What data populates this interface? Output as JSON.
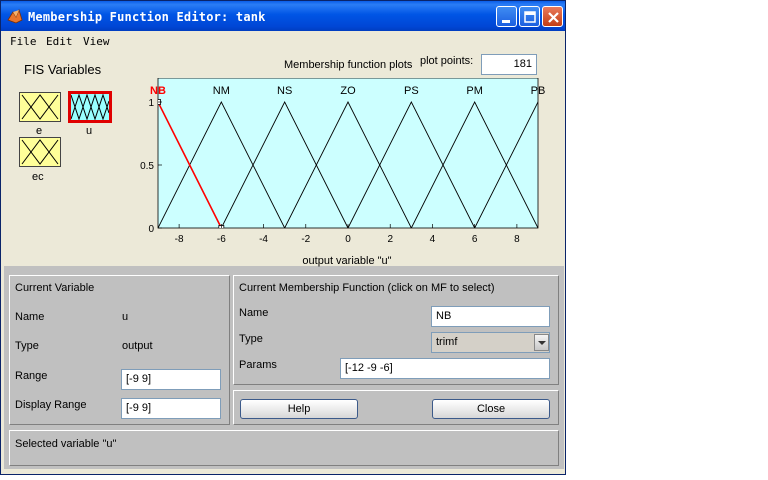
{
  "window": {
    "title": "Membership Function Editor: tank",
    "controls": [
      "minimize-icon",
      "maximize-icon",
      "close-icon"
    ]
  },
  "menu": [
    "File",
    "Edit",
    "View"
  ],
  "fis_variables": {
    "heading": "FIS Variables",
    "inputs": [
      "e",
      "ec"
    ],
    "output": "u",
    "selected": "u"
  },
  "plot": {
    "title": "Membership function plots",
    "plot_points_label": "plot points:",
    "plot_points_value": "181",
    "xlabel": "output variable \"u\"",
    "x_ticks": [
      "-8",
      "-6",
      "-4",
      "-2",
      "0",
      "2",
      "4",
      "6",
      "8"
    ],
    "y_ticks": [
      "0",
      "0.5",
      "1"
    ],
    "mf_labels": [
      "NB",
      "NM",
      "NS",
      "ZO",
      "PS",
      "PM",
      "PB"
    ],
    "background_color": "#ccffff",
    "selected_color": "#ff0000"
  },
  "chart_data": {
    "type": "line",
    "x_range": [
      -9,
      9
    ],
    "y_range": [
      0,
      1
    ],
    "xlabel": "output variable \"u\"",
    "series": [
      {
        "name": "NB",
        "x": [
          -12,
          -9,
          -6
        ],
        "y": [
          0,
          1,
          0
        ]
      },
      {
        "name": "NM",
        "x": [
          -9,
          -6,
          -3
        ],
        "y": [
          0,
          1,
          0
        ]
      },
      {
        "name": "NS",
        "x": [
          -6,
          -3,
          0
        ],
        "y": [
          0,
          1,
          0
        ]
      },
      {
        "name": "ZO",
        "x": [
          -3,
          0,
          3
        ],
        "y": [
          0,
          1,
          0
        ]
      },
      {
        "name": "PS",
        "x": [
          0,
          3,
          6
        ],
        "y": [
          0,
          1,
          0
        ]
      },
      {
        "name": "PM",
        "x": [
          3,
          6,
          9
        ],
        "y": [
          0,
          1,
          0
        ]
      },
      {
        "name": "PB",
        "x": [
          6,
          9,
          12
        ],
        "y": [
          0,
          1,
          0
        ]
      }
    ],
    "selected_series": "NB"
  },
  "current_variable": {
    "heading": "Current Variable",
    "name_label": "Name",
    "name_value": "u",
    "type_label": "Type",
    "type_value": "output",
    "range_label": "Range",
    "range_value": "[-9 9]",
    "display_range_label": "Display Range",
    "display_range_value": "[-9 9]"
  },
  "current_mf": {
    "heading": "Current Membership Function (click on MF to select)",
    "name_label": "Name",
    "name_value": "NB",
    "type_label": "Type",
    "type_value": "trimf",
    "params_label": "Params",
    "params_value": "[-12 -9 -6]"
  },
  "buttons": {
    "help": "Help",
    "close": "Close"
  },
  "status": {
    "text": "Selected variable \"u\""
  }
}
